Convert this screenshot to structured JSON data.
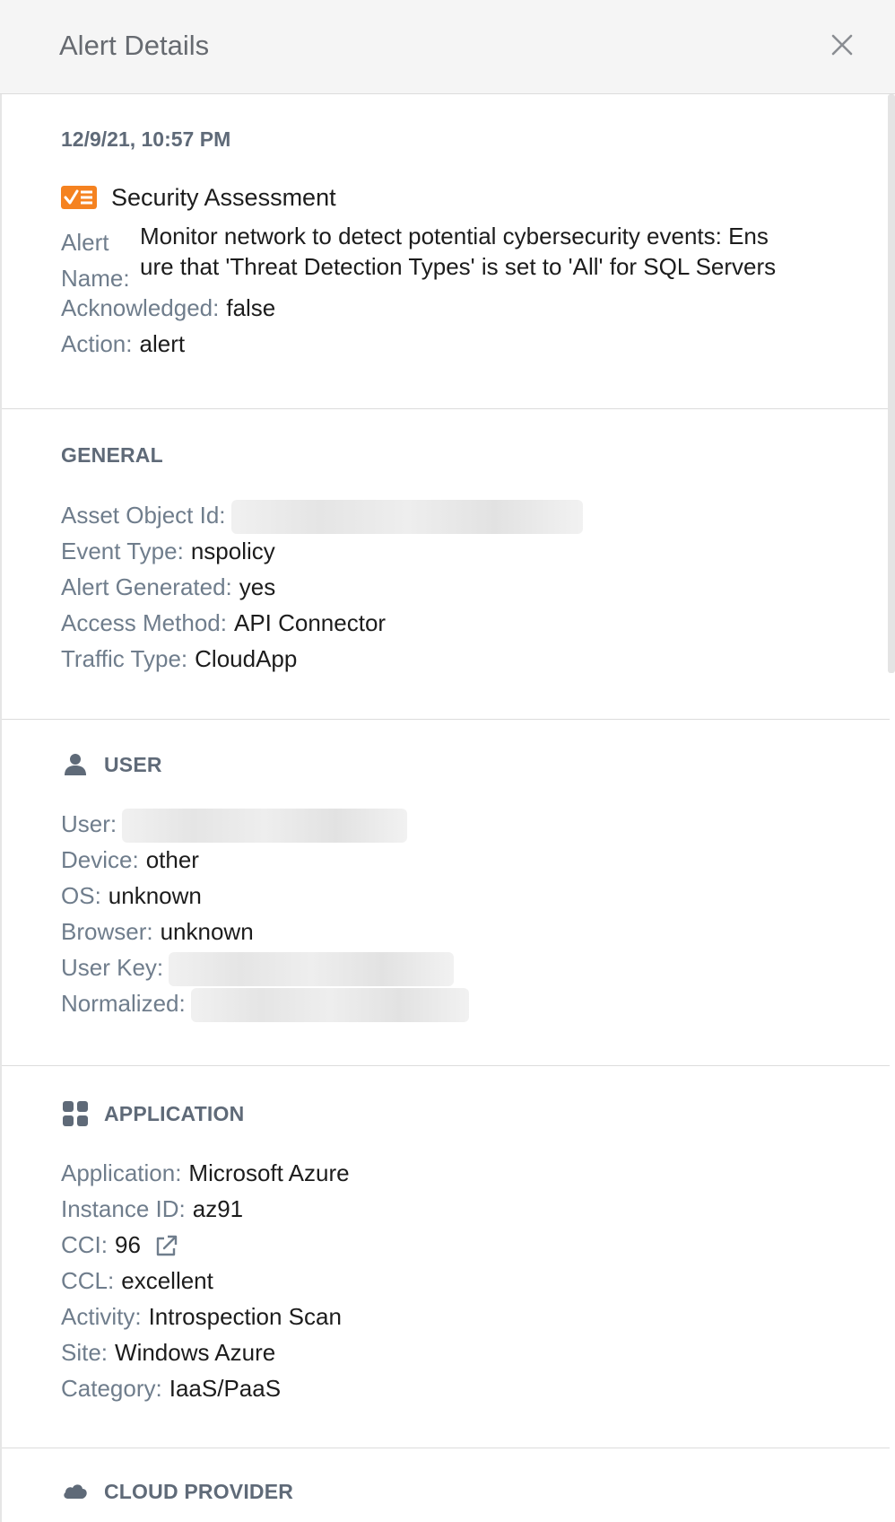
{
  "header": {
    "title": "Alert Details"
  },
  "summary": {
    "timestamp": "12/9/21, 10:57 PM",
    "alert_type": "Security Assessment",
    "alert_name_label": "Alert Name:",
    "alert_name_line1": "Monitor network to detect potential cybersecurity events: Ens",
    "alert_name_line2": "ure that 'Threat Detection Types' is set to 'All' for SQL Servers",
    "acknowledged_label": "Acknowledged:",
    "acknowledged_value": "false",
    "action_label": "Action:",
    "action_value": "alert"
  },
  "general": {
    "title": "GENERAL",
    "asset_object_id_label": "Asset Object Id:",
    "event_type_label": "Event Type:",
    "event_type_value": "nspolicy",
    "alert_generated_label": "Alert Generated:",
    "alert_generated_value": "yes",
    "access_method_label": "Access Method:",
    "access_method_value": "API Connector",
    "traffic_type_label": "Traffic Type:",
    "traffic_type_value": "CloudApp"
  },
  "user": {
    "title": "USER",
    "user_label": "User:",
    "device_label": "Device:",
    "device_value": "other",
    "os_label": "OS:",
    "os_value": "unknown",
    "browser_label": "Browser:",
    "browser_value": "unknown",
    "user_key_label": "User Key:",
    "normalized_label": "Normalized:"
  },
  "application": {
    "title": "APPLICATION",
    "application_label": "Application:",
    "application_value": "Microsoft Azure",
    "instance_id_label": "Instance ID:",
    "instance_id_value": "az91",
    "cci_label": "CCI:",
    "cci_value": "96",
    "ccl_label": "CCL:",
    "ccl_value": "excellent",
    "activity_label": "Activity:",
    "activity_value": "Introspection Scan",
    "site_label": "Site:",
    "site_value": "Windows Azure",
    "category_label": "Category:",
    "category_value": "IaaS/PaaS"
  },
  "cloud_provider": {
    "title": "CLOUD PROVIDER"
  },
  "icons": {
    "close": "close-icon",
    "security_assessment": "checklist-icon",
    "user": "person-icon",
    "application": "grid-icon",
    "cloud_provider": "cloud-icon",
    "external_link": "external-link-icon"
  },
  "colors": {
    "badge": "#f58220",
    "label": "#6f7d8c",
    "value": "#1c1c1c",
    "section_title": "#5f6a78"
  }
}
